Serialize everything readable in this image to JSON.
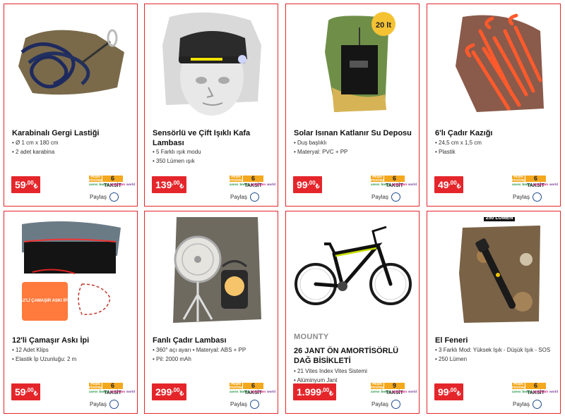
{
  "currency": "₺",
  "installment": {
    "pesin_line1": "PEŞİN",
    "pesin_line2": "FİYATINA",
    "taksit_word": "TAKSİT",
    "banks": [
      "axess",
      "bonus",
      "maximum",
      "world"
    ]
  },
  "share_label": "Paylaş",
  "products": [
    {
      "brand": "",
      "title": "Karabinalı Gergi Lastiği",
      "specs": [
        "Ø 1 cm x 180 cm",
        "2 adet karabina"
      ],
      "price_int": "59",
      "price_dec": "00",
      "taksit_count": "6",
      "image_icon": "bungee-cord-icon"
    },
    {
      "brand": "",
      "title": "Sensörlü ve Çift Işıklı Kafa Lambası",
      "specs": [
        "5 Farklı ışık modu",
        "350 Lümen ışık"
      ],
      "price_int": "139",
      "price_dec": "00",
      "taksit_count": "6",
      "image_icon": "headlamp-icon"
    },
    {
      "brand": "",
      "title": "Solar Isınan Katlanır Su Deposu",
      "specs": [
        "Duş başlıklı",
        "Materyal: PVC + PP"
      ],
      "price_int": "99",
      "price_dec": "00",
      "taksit_count": "6",
      "image_icon": "solar-water-bag-icon",
      "badge": "20 lt"
    },
    {
      "brand": "",
      "title": "6'lı Çadır Kazığı",
      "specs": [
        "24,5 cm x 1,5 cm",
        "Plastik"
      ],
      "price_int": "49",
      "price_dec": "00",
      "taksit_count": "6",
      "image_icon": "tent-stake-icon"
    },
    {
      "brand": "",
      "title": "12'li Çamaşır Askı İpi",
      "specs": [
        "12 Adet Klips",
        "Elastik İp Uzunluğu: 2 m"
      ],
      "price_int": "59",
      "price_dec": "00",
      "taksit_count": "6",
      "image_icon": "clothesline-icon",
      "badge": "12'Lİ ÇAMAŞIR ASKI İPİ"
    },
    {
      "brand": "",
      "title": "Fanlı Çadır Lambası",
      "specs": [
        "360° açı ayarı • Materyal: ABS + PP",
        "Pil: 2000 mAh"
      ],
      "price_int": "299",
      "price_dec": "00",
      "taksit_count": "6",
      "image_icon": "fan-lamp-icon"
    },
    {
      "brand": "MOUNTY",
      "title": "26 JANT ÖN AMORTİSÖRLÜ DAĞ BİSİKLETİ",
      "specs": [
        "21 Vites Index Vites Sistemi",
        "Alüminyum Jant"
      ],
      "price_int": "1.999",
      "price_dec": "00",
      "taksit_count": "9",
      "image_icon": "mountain-bike-icon"
    },
    {
      "brand": "",
      "title": "El Feneri",
      "specs": [
        "3 Farklı Mod: Yüksek Işık - Düşük Işık - SOS",
        "250 Lümen"
      ],
      "price_int": "99",
      "price_dec": "00",
      "taksit_count": "6",
      "image_icon": "flashlight-icon",
      "badge": "250 LÜMEN"
    }
  ]
}
